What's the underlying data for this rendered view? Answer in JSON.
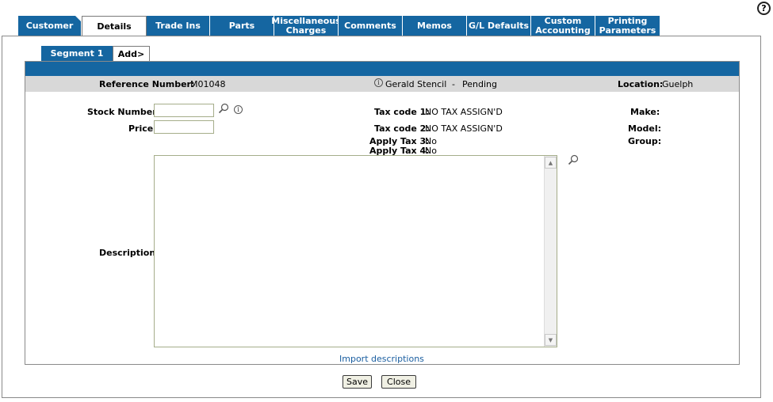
{
  "tabs": [
    {
      "label": "Customer"
    },
    {
      "label": "Details"
    },
    {
      "label": "Trade Ins"
    },
    {
      "label": "Parts"
    },
    {
      "label": "Miscellaneous Charges"
    },
    {
      "label": "Comments"
    },
    {
      "label": "Memos"
    },
    {
      "label": "G/L Defaults"
    },
    {
      "label": "Custom Accounting"
    },
    {
      "label": "Printing Parameters"
    }
  ],
  "segments": {
    "segment1": "Segment 1",
    "add": "Add>"
  },
  "header": {
    "reference_label": "Reference Number:",
    "reference_value": "M01048",
    "customer": "Gerald Stencil",
    "separator": "-",
    "status": "Pending",
    "location_label": "Location:",
    "location_value": "Guelph"
  },
  "form": {
    "stock_label": "Stock Number:",
    "stock_value": "",
    "price_label": "Price:",
    "price_value": "",
    "tax1_label": "Tax code 1:",
    "tax1_value": "NO TAX ASSIGN'D",
    "tax2_label": "Tax code 2:",
    "tax2_value": "NO TAX ASSIGN'D",
    "apply3_label": "Apply Tax 3:",
    "apply3_value": "No",
    "apply4_label": "Apply Tax 4:",
    "apply4_value": "No",
    "make_label": "Make:",
    "model_label": "Model:",
    "group_label": "Group:",
    "description_label": "Description:",
    "description_value": "",
    "import_link": "Import descriptions"
  },
  "buttons": {
    "save": "Save",
    "close": "Close"
  },
  "help": "?",
  "colors": {
    "tab_blue": "#1566a1",
    "band_grey": "#d8d8d8",
    "link": "#1a5ea0"
  }
}
